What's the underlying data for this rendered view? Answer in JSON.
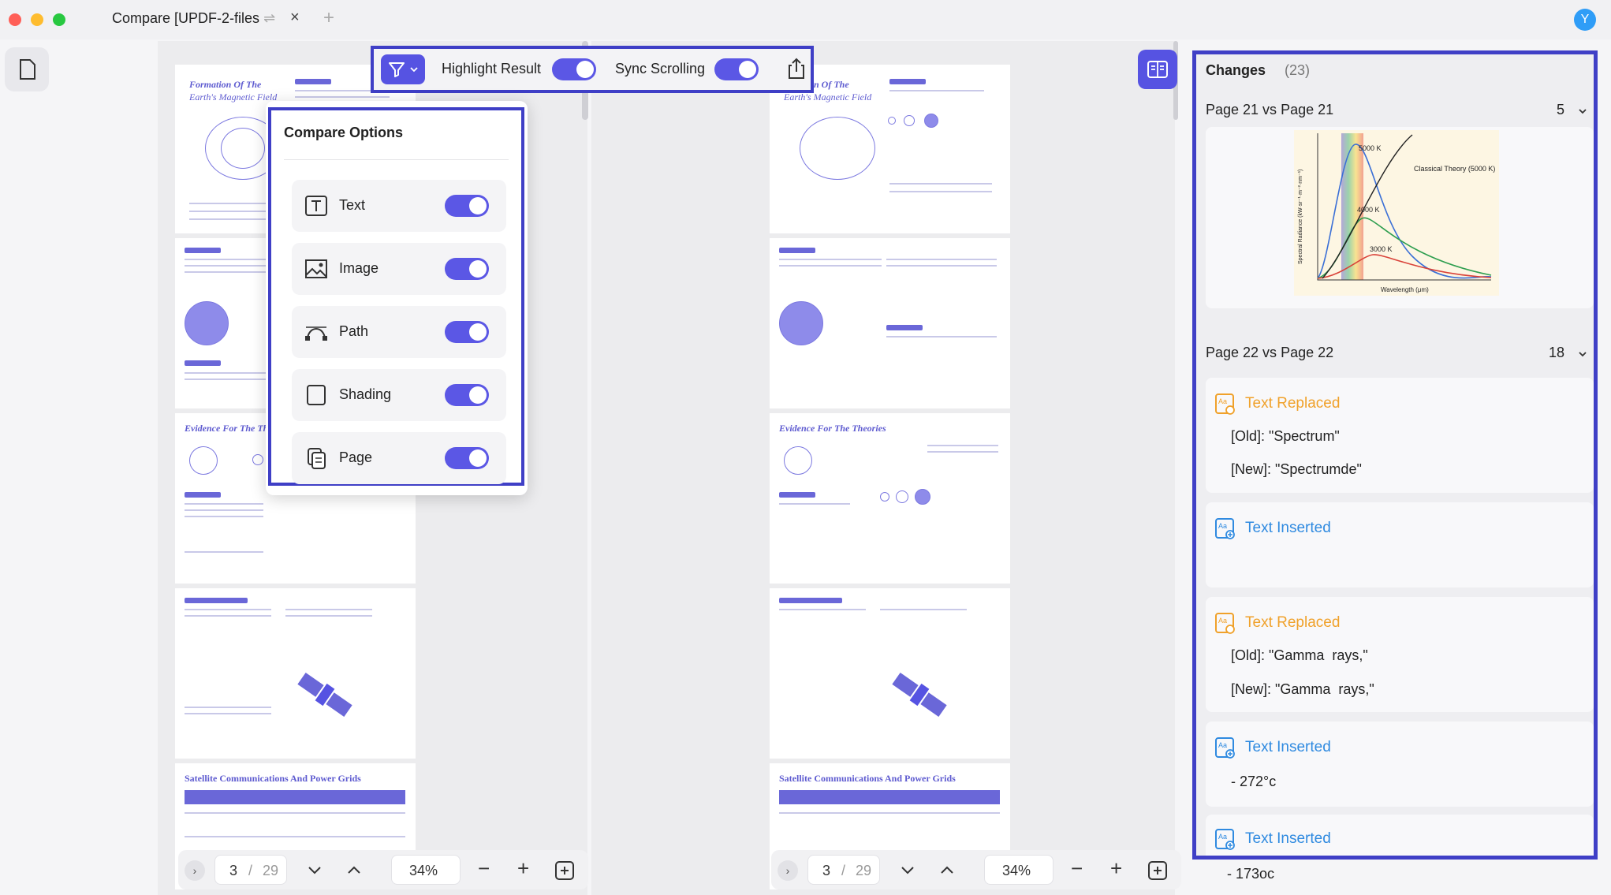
{
  "window": {
    "tab_title": "Compare [UPDF-2-files",
    "tab_close": "×",
    "tab_add": "+",
    "avatar_letter": "Y"
  },
  "toolbar": {
    "highlight_label": "Highlight Result",
    "sync_label": "Sync Scrolling",
    "highlight_on": true,
    "sync_on": true
  },
  "compare_options": {
    "title": "Compare Options",
    "items": [
      {
        "label": "Text",
        "icon": "text-box-icon",
        "enabled": true
      },
      {
        "label": "Image",
        "icon": "image-icon",
        "enabled": true
      },
      {
        "label": "Path",
        "icon": "bezier-path-icon",
        "enabled": true
      },
      {
        "label": "Shading",
        "icon": "shading-square-icon",
        "enabled": true
      },
      {
        "label": "Page",
        "icon": "page-copy-icon",
        "enabled": true
      }
    ]
  },
  "documents": {
    "left": {
      "page_titles": [
        "Formation Of The",
        "Earth's Magnetic Field",
        "Evidence For The The",
        "Satellite Communications And Power Grids"
      ],
      "current_page": "3",
      "separator": "/",
      "total_pages": "29",
      "zoom": "34%"
    },
    "right": {
      "page_titles": [
        "on Of The",
        "Earth's Magnetic Field",
        "Evidence For The Theories",
        "Satellite Communications And Power Grids"
      ],
      "current_page": "3",
      "separator": "/",
      "total_pages": "29",
      "zoom": "34%"
    }
  },
  "changes": {
    "title": "Changes",
    "count": "(23)",
    "groups": [
      {
        "label": "Page 21 vs Page 21",
        "count": "5"
      },
      {
        "label": "Page 22 vs Page 22",
        "count": "18"
      }
    ],
    "chart_labels": {
      "peak1": "5000 K",
      "peak2": "4000 K",
      "peak3": "3000 K",
      "classical": "Classical Theory (5000 K)",
      "xlabel": "Wavelength (μm)",
      "ylabel": "Spectral Radiance (kW·sr⁻¹·m⁻²·nm⁻¹)"
    },
    "items": [
      {
        "type": "Text Replaced",
        "old": "[Old]: \"Spectrum\"",
        "new": "[New]: \"Spectrumde\""
      },
      {
        "type": "Text Inserted",
        "text": ""
      },
      {
        "type": "Text Replaced",
        "old": "[Old]: \"Gamma  rays,\"",
        "new": "[New]: \"Gamma  rays,\""
      },
      {
        "type": "Text Inserted",
        "text": "- 272°c"
      },
      {
        "type": "Text Inserted",
        "text": "- 173oc"
      }
    ]
  },
  "colors": {
    "accent": "#5653e2",
    "frame": "#3f3fc6",
    "replaced": "#f0a12a",
    "inserted": "#2f8ae0"
  }
}
